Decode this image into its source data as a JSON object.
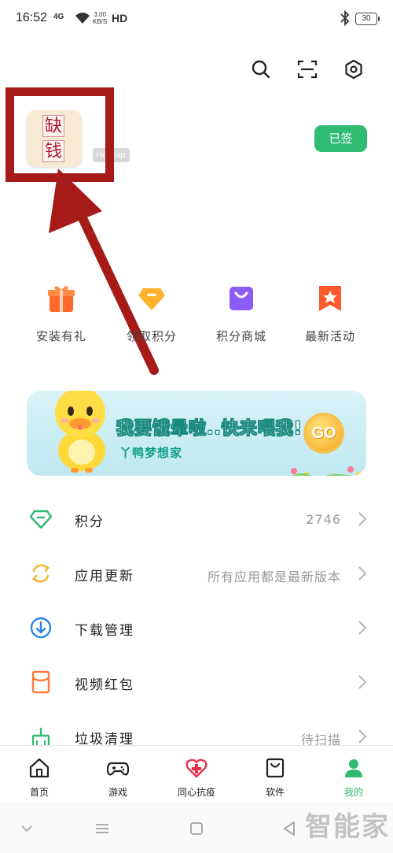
{
  "status_bar": {
    "time": "16:52",
    "network": "4G",
    "speed_top": "3.00",
    "speed_bottom": "KB/S",
    "hd": "HD",
    "battery": "30"
  },
  "profile": {
    "avatar_chars": [
      "缺",
      "钱"
    ],
    "badge": "HeyTap",
    "signed_label": "已签"
  },
  "quick_actions": [
    {
      "label": "安装有礼",
      "icon": "gift-icon",
      "color": "#ff6a2b"
    },
    {
      "label": "领取积分",
      "icon": "diamond-icon",
      "color": "#ffb22c"
    },
    {
      "label": "积分商城",
      "icon": "shopping-bag-icon",
      "color": "#8a5bf5"
    },
    {
      "label": "最新活动",
      "icon": "star-ribbon-icon",
      "color": "#ff5a2b"
    }
  ],
  "banner": {
    "title": "我要饿晕啦..快来喂我!",
    "subtitle": "丫鸭梦想家",
    "coin_text": "GO"
  },
  "menu": [
    {
      "label": "积分",
      "value": "2746",
      "icon": "diamond-outline-icon"
    },
    {
      "label": "应用更新",
      "value": "所有应用都是最新版本",
      "icon": "refresh-icon"
    },
    {
      "label": "下载管理",
      "value": "",
      "icon": "download-icon"
    },
    {
      "label": "视频红包",
      "value": "",
      "icon": "red-envelope-icon"
    },
    {
      "label": "垃圾清理",
      "value": "待扫描",
      "icon": "broom-icon"
    }
  ],
  "bottom_nav": [
    {
      "label": "首页",
      "icon": "home-icon"
    },
    {
      "label": "游戏",
      "icon": "gamepad-icon"
    },
    {
      "label": "同心抗疫",
      "icon": "heart-cross-icon"
    },
    {
      "label": "软件",
      "icon": "app-bag-icon"
    },
    {
      "label": "我的",
      "icon": "user-icon",
      "active": true
    }
  ],
  "watermark": "智能家",
  "colors": {
    "accent": "#2fbb72",
    "annotation": "#a61b18"
  }
}
